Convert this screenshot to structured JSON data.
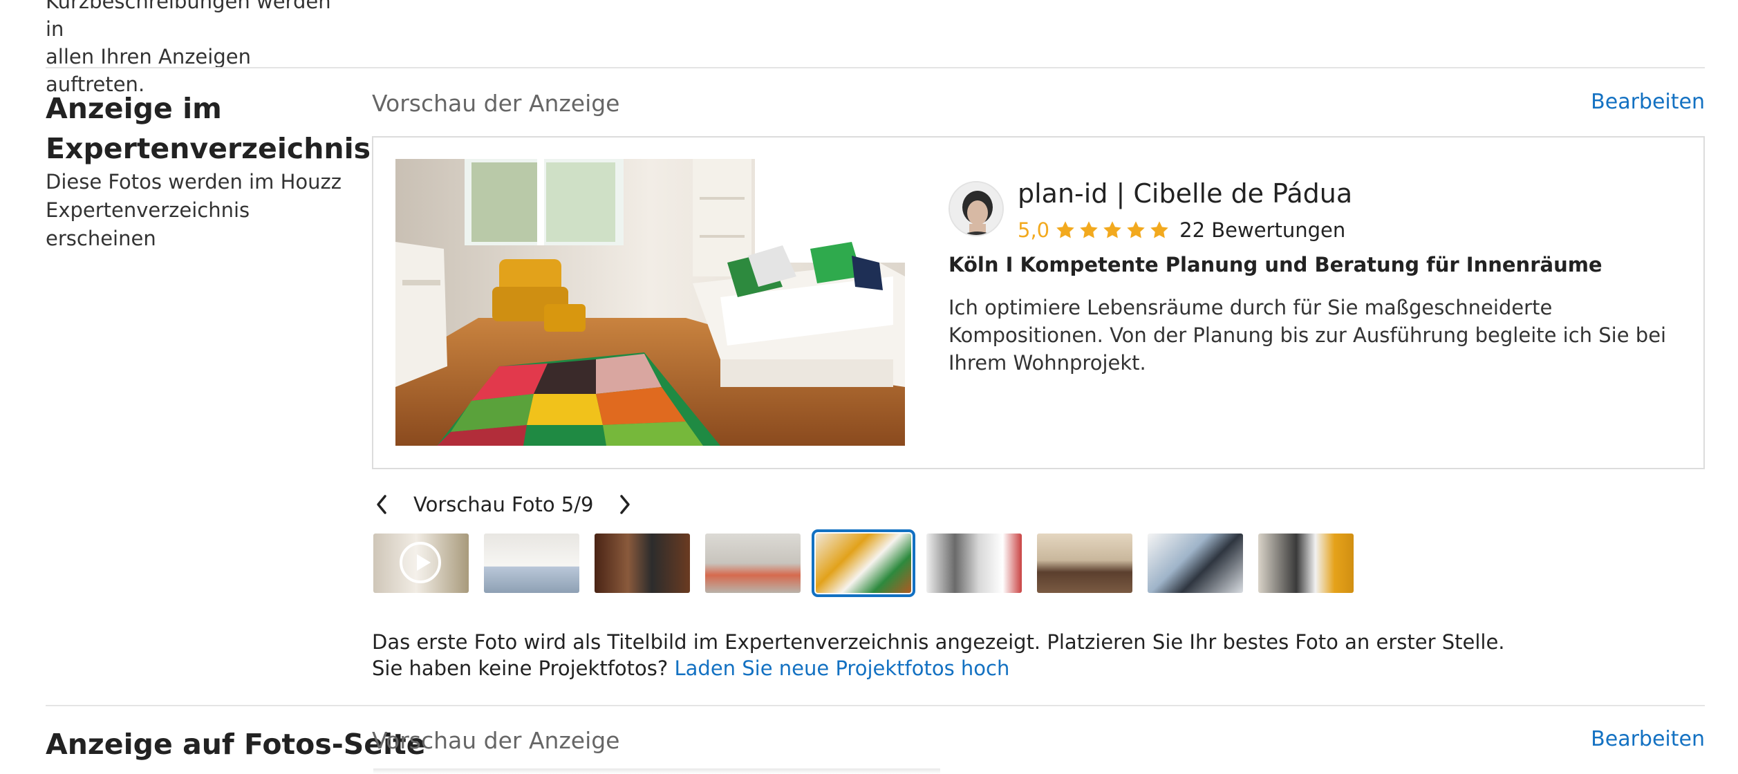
{
  "intro": {
    "line1": "Kurzbeschreibungen werden in",
    "line2": "allen Ihren Anzeigen auftreten."
  },
  "section_directory": {
    "title_line1": "Anzeige im",
    "title_line2": "Expertenverzeichnis",
    "desc_line1": "Diese Fotos werden im Houzz",
    "desc_line2": "Expertenverzeichnis erscheinen",
    "preview_label": "Vorschau der Anzeige",
    "edit_label": "Bearbeiten"
  },
  "listing": {
    "name": "plan-id | Cibelle de Pádua",
    "rating": "5,0",
    "stars": 5,
    "reviews": "22 Bewertungen",
    "tagline": "Köln I Kompetente Planung und Beratung für Innenräume",
    "about": "Ich optimiere Lebensräume durch für Sie maßgeschneiderte Kompositionen. Von der Planung bis zur Ausführung begleite ich Sie bei Ihrem Wohnprojekt."
  },
  "photo_nav": {
    "label": "Vorschau Foto 5/9",
    "prev_icon": "chevron-left-icon",
    "next_icon": "chevron-right-icon",
    "selected_index": 5,
    "total": 9
  },
  "footer": {
    "line1": "Das erste Foto wird als Titelbild im Expertenverzeichnis angezeigt. Platzieren Sie Ihr bestes Foto an erster Stelle.",
    "line2_prefix": "Sie haben keine Projektfotos?",
    "line2_link": "Laden Sie neue Projektfotos hoch"
  },
  "section_photos": {
    "title": "Anzeige auf Fotos-Seite",
    "preview_label": "Vorschau der Anzeige",
    "edit_label": "Bearbeiten"
  },
  "colors": {
    "accent": "#1371c2",
    "star": "#f2a91e",
    "divider": "#e4e4e4"
  }
}
